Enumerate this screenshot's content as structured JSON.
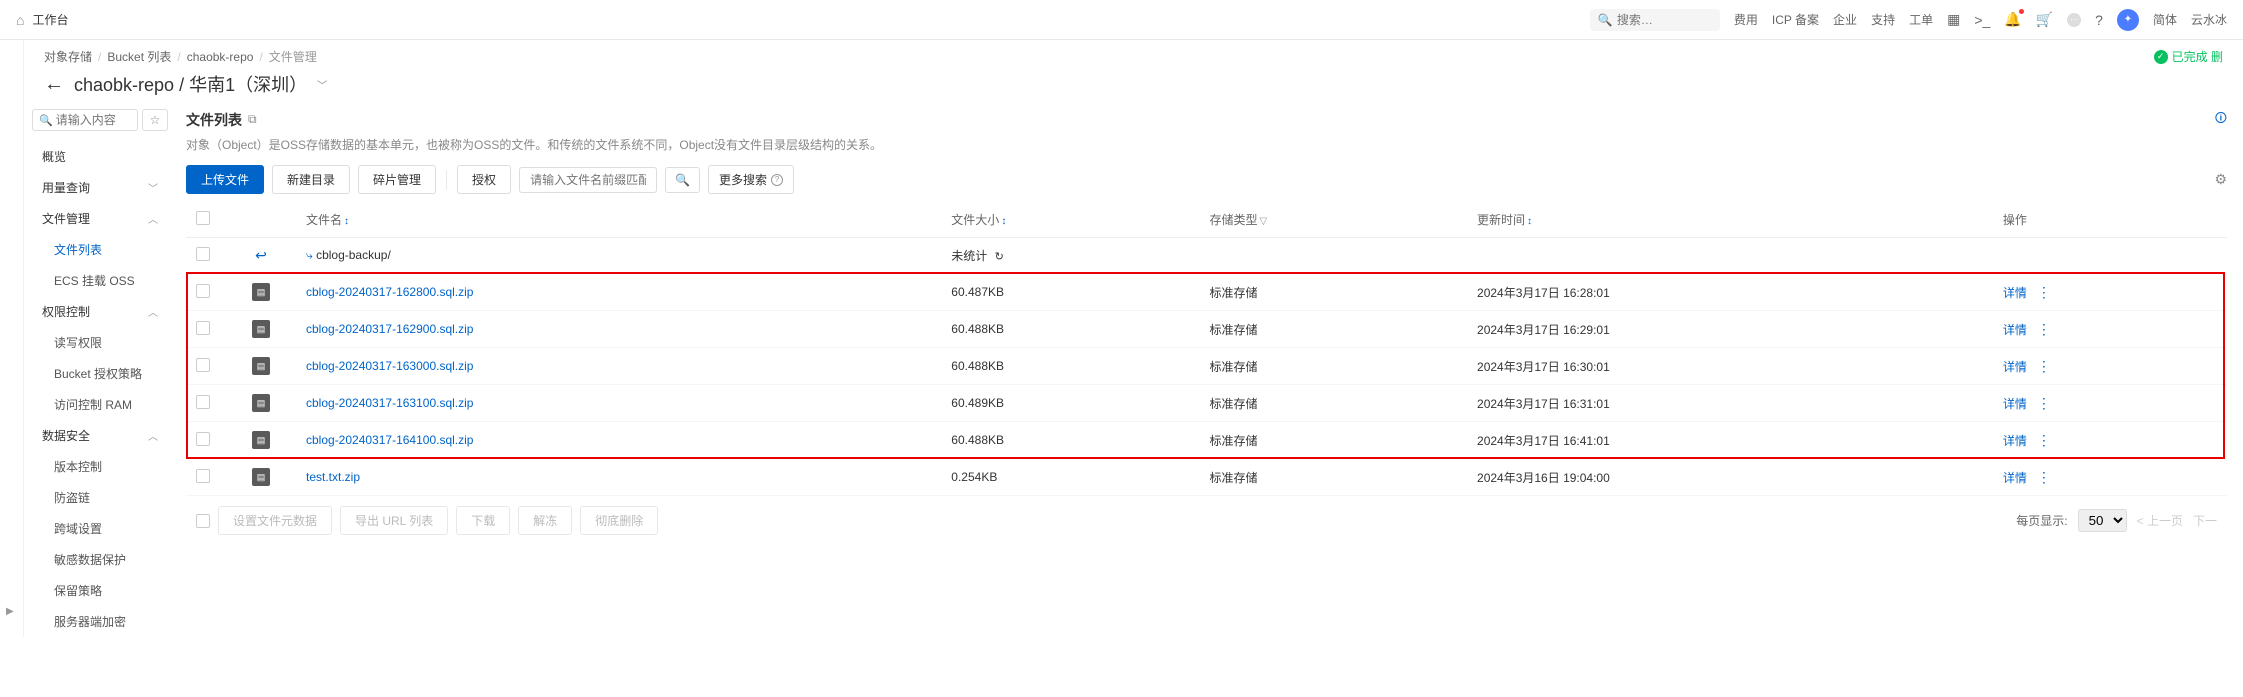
{
  "topbar": {
    "workbench": "工作台",
    "search_placeholder": "搜索…",
    "links": [
      "费用",
      "ICP 备案",
      "企业",
      "支持",
      "工单"
    ],
    "lang": "简体",
    "username": "云水冰"
  },
  "breadcrumb": {
    "items": [
      "对象存储",
      "Bucket 列表",
      "chaobk-repo"
    ],
    "current": "文件管理"
  },
  "status_msg": "已完成 删",
  "page_title_bucket": "chaobk-repo",
  "page_title_region": "华南1（深圳）",
  "sidebar": {
    "search_placeholder": "请输入内容",
    "items": [
      {
        "label": "概览",
        "level": 1,
        "expand": false
      },
      {
        "label": "用量查询",
        "level": 1,
        "expand": true,
        "chevron": true
      },
      {
        "label": "文件管理",
        "level": 1,
        "expand": true,
        "chevron": true
      },
      {
        "label": "文件列表",
        "level": 2,
        "active": true
      },
      {
        "label": "ECS 挂载 OSS",
        "level": 2
      },
      {
        "label": "权限控制",
        "level": 1,
        "expand": true,
        "chevron": true
      },
      {
        "label": "读写权限",
        "level": 2
      },
      {
        "label": "Bucket 授权策略",
        "level": 2
      },
      {
        "label": "访问控制 RAM",
        "level": 2
      },
      {
        "label": "数据安全",
        "level": 1,
        "expand": true,
        "chevron": true
      },
      {
        "label": "版本控制",
        "level": 2
      },
      {
        "label": "防盗链",
        "level": 2
      },
      {
        "label": "跨域设置",
        "level": 2
      },
      {
        "label": "敏感数据保护",
        "level": 2
      },
      {
        "label": "保留策略",
        "level": 2
      },
      {
        "label": "服务器端加密",
        "level": 2
      }
    ]
  },
  "section": {
    "title": "文件列表",
    "description": "对象（Object）是OSS存储数据的基本单元，也被称为OSS的文件。和传统的文件系统不同，Object没有文件目录层级结构的关系。"
  },
  "toolbar": {
    "upload": "上传文件",
    "new_dir": "新建目录",
    "fragment": "碎片管理",
    "auth": "授权",
    "prefix_placeholder": "请输入文件名前缀匹配",
    "more_search": "更多搜索"
  },
  "table": {
    "headers": {
      "name": "文件名",
      "size": "文件大小",
      "storage": "存储类型",
      "updated": "更新时间",
      "action": "操作"
    },
    "parent_folder": "cblog-backup/",
    "unstat": "未统计",
    "detail_label": "详情",
    "rows": [
      {
        "name": "cblog-20240317-162800.sql.zip",
        "size": "60.487KB",
        "storage": "标准存储",
        "updated": "2024年3月17日 16:28:01",
        "hl": true
      },
      {
        "name": "cblog-20240317-162900.sql.zip",
        "size": "60.488KB",
        "storage": "标准存储",
        "updated": "2024年3月17日 16:29:01",
        "hl": true
      },
      {
        "name": "cblog-20240317-163000.sql.zip",
        "size": "60.488KB",
        "storage": "标准存储",
        "updated": "2024年3月17日 16:30:01",
        "hl": true
      },
      {
        "name": "cblog-20240317-163100.sql.zip",
        "size": "60.489KB",
        "storage": "标准存储",
        "updated": "2024年3月17日 16:31:01",
        "hl": true
      },
      {
        "name": "cblog-20240317-164100.sql.zip",
        "size": "60.488KB",
        "storage": "标准存储",
        "updated": "2024年3月17日 16:41:01",
        "hl": true
      },
      {
        "name": "test.txt.zip",
        "size": "0.254KB",
        "storage": "标准存储",
        "updated": "2024年3月16日 19:04:00",
        "hl": false
      }
    ]
  },
  "bottom": {
    "set_meta": "设置文件元数据",
    "export_url": "导出 URL 列表",
    "download": "下载",
    "unfreeze": "解冻",
    "delete": "彻底删除",
    "per_page_label": "每页显示:",
    "per_page_value": "50",
    "prev": "上一页",
    "next": "下一"
  }
}
